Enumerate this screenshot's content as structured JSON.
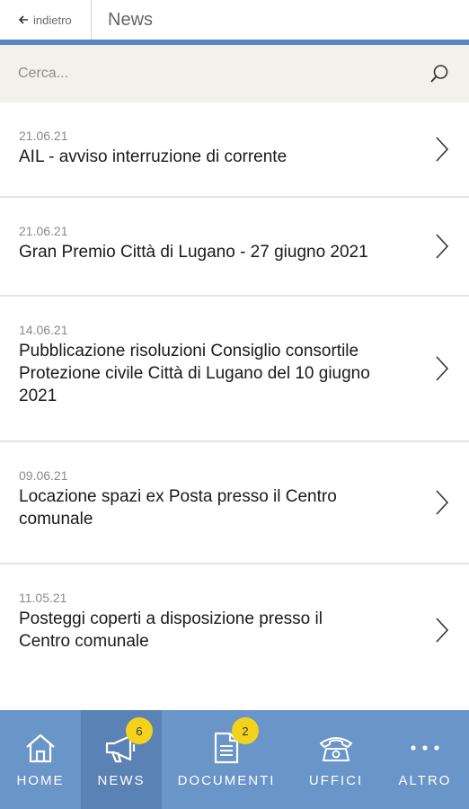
{
  "header": {
    "back_label": "indietro",
    "title": "News"
  },
  "colors": {
    "accent": "#5b86c4",
    "tabbar": "#6a95c9",
    "tab_active": "#5a82b5",
    "badge": "#f2d21a",
    "search_bg": "#f2f1ea"
  },
  "search": {
    "placeholder": "Cerca..."
  },
  "news": [
    {
      "date": "21.06.21",
      "title": "AIL - avviso interruzione di corrente"
    },
    {
      "date": "21.06.21",
      "title": "Gran Premio Città di Lugano - 27 giugno 2021"
    },
    {
      "date": "14.06.21",
      "title": "Pubblicazione risoluzioni Consiglio consortile Protezione civile Città di Lugano del 10 giugno 2021"
    },
    {
      "date": "09.06.21",
      "title": "Locazione spazi ex Posta presso il Centro comunale"
    },
    {
      "date": "11.05.21",
      "title": "Posteggi coperti a disposizione presso il Centro comunale"
    }
  ],
  "tabs": [
    {
      "label": "HOME",
      "icon": "home-icon"
    },
    {
      "label": "NEWS",
      "icon": "megaphone-icon",
      "badge": "6",
      "active": true
    },
    {
      "label": "DOCUMENTI",
      "icon": "document-icon",
      "badge": "2"
    },
    {
      "label": "UFFICI",
      "icon": "phone-icon"
    },
    {
      "label": "ALTRO",
      "icon": "more-icon"
    }
  ]
}
